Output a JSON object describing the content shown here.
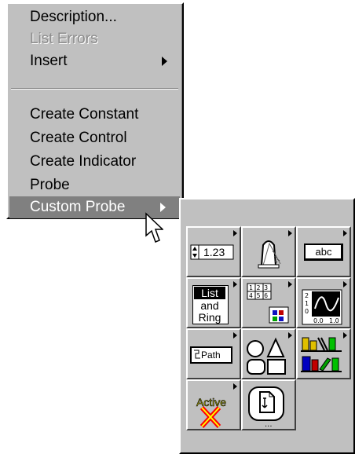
{
  "menu": {
    "items": [
      {
        "label": "Description...",
        "disabled": false
      },
      {
        "label": "List Errors",
        "disabled": true
      },
      {
        "label": "Insert",
        "disabled": false,
        "submenu": true
      },
      {
        "label": "Create Constant",
        "disabled": false
      },
      {
        "label": "Create Control",
        "disabled": false
      },
      {
        "label": "Create Indicator",
        "disabled": false
      },
      {
        "label": "Probe",
        "disabled": false
      },
      {
        "label": "Custom Probe",
        "disabled": false,
        "submenu": true,
        "selected": true
      }
    ]
  },
  "palette": {
    "tiles": [
      {
        "name": "numeric-probe",
        "text": "1.23",
        "icon": "numeric-icon"
      },
      {
        "name": "boolean-probe",
        "icon": "boolean-light-icon"
      },
      {
        "name": "string-probe",
        "text": "abc",
        "icon": "string-icon"
      },
      {
        "name": "list-ring-probe",
        "lines": [
          "List",
          "and",
          "Ring"
        ],
        "icon": "list-ring-icon"
      },
      {
        "name": "array-cluster-probe",
        "text": "123 456",
        "icon": "array-cluster-icon"
      },
      {
        "name": "graph-probe",
        "axis": [
          "2",
          "1",
          "0",
          "0.0",
          "1.0"
        ],
        "icon": "graph-icon"
      },
      {
        "name": "path-probe",
        "text": "Path",
        "icon": "path-icon"
      },
      {
        "name": "decorations-probe",
        "icon": "decorations-icon"
      },
      {
        "name": "classic-probe",
        "icon": "classic-controls-icon"
      },
      {
        "name": "activex-probe",
        "text": "Active",
        "icon": "activex-icon"
      },
      {
        "name": "select-probe",
        "icon": "select-vi-icon"
      }
    ]
  },
  "colors": {
    "menu_bg": "#c0c0c0",
    "highlight": "#808080",
    "disabled_text": "#8c8c8c"
  }
}
